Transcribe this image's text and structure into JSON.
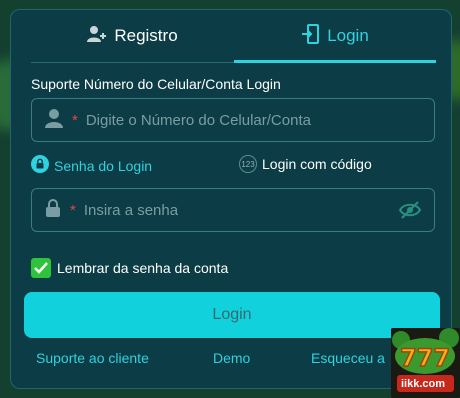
{
  "tabs": {
    "registro": "Registro",
    "login": "Login"
  },
  "form": {
    "section_label": "Suporte Número do Celular/Conta Login",
    "phone_placeholder": "Digite o Número do Celular/Conta",
    "password_placeholder": "Insira a senha",
    "required_mark": "*"
  },
  "login_modes": {
    "senha": "Senha do Login",
    "codigo": "Login com código",
    "codigo_badge": "123"
  },
  "remember": {
    "label": "Lembrar da senha da conta",
    "checked": true
  },
  "login_button": "Login",
  "links": {
    "suporte": "Suporte ao cliente",
    "demo": "Demo",
    "esqueceu": "Esqueceu a"
  },
  "logo": {
    "text": "iikk.com",
    "digits": "777"
  },
  "colors": {
    "accent": "#2fd2df",
    "button": "#11d2dc",
    "panel": "#0c3c45",
    "check": "#2ec33b",
    "required": "#e0494c"
  }
}
